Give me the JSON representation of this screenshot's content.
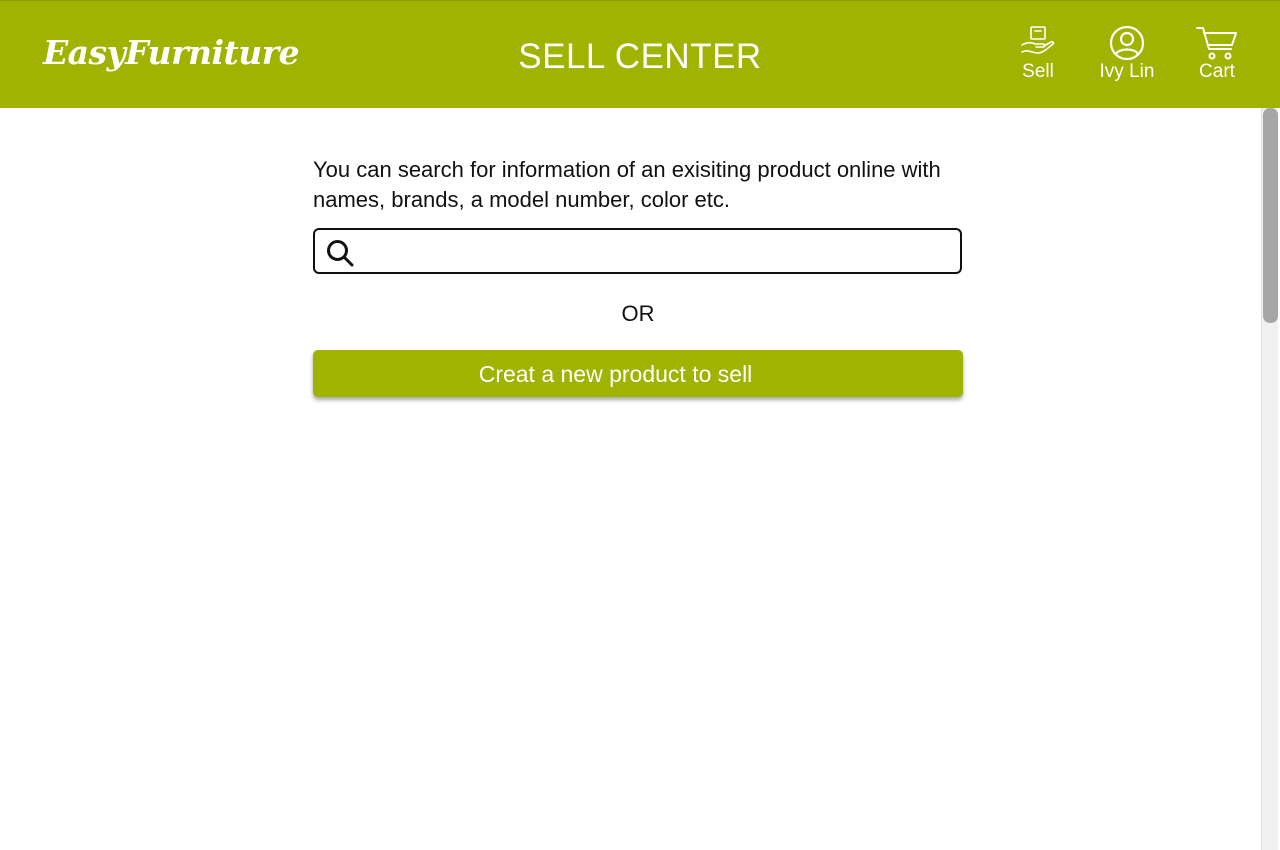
{
  "header": {
    "logo": "EasyFurniture",
    "title": "SELL CENTER",
    "nav": {
      "sell": {
        "label": "Sell",
        "icon": "sell-hand-box-icon"
      },
      "user": {
        "label": "Ivy Lin",
        "icon": "user-circle-icon"
      },
      "cart": {
        "label": "Cart",
        "icon": "shopping-cart-icon"
      }
    }
  },
  "main": {
    "intro": "You can search for information of an exisiting product online with names, brands, a model number, color etc.",
    "search": {
      "value": "",
      "placeholder": "",
      "icon": "search-icon"
    },
    "or_text": "OR",
    "create_button": "Creat a new product to sell"
  },
  "colors": {
    "brand": "#a0b301",
    "text": "#111111",
    "background": "#ffffff"
  }
}
